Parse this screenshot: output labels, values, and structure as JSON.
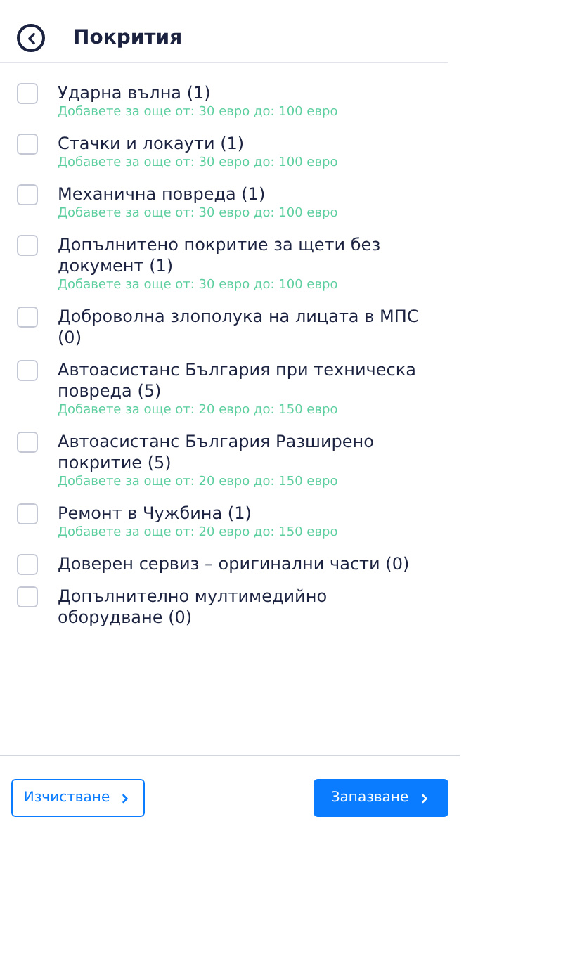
{
  "header": {
    "title": "Покрития"
  },
  "coverages": [
    {
      "label": "Ударна вълна (1)",
      "checked": false,
      "hint": "Добавете за още от: 30 евро до: 100 евро"
    },
    {
      "label": "Стачки и локаути (1)",
      "checked": false,
      "hint": "Добавете за още от: 30 евро до: 100 евро"
    },
    {
      "label": "Механична повреда (1)",
      "checked": false,
      "hint": "Добавете за още от: 30 евро до: 100 евро"
    },
    {
      "label": "Допълнитено покритие за щети без документ (1)",
      "checked": false,
      "hint": "Добавете за още от: 30 евро до: 100 евро"
    },
    {
      "label": "Доброволна злополука на лицата в МПС (0)",
      "checked": false
    },
    {
      "label": "Автоасистанс България при техническа повреда (5)",
      "checked": false,
      "hint": "Добавете за още от: 20 евро до: 150 евро"
    },
    {
      "label": "Автоасистанс България Разширено покритие (5)",
      "checked": false,
      "hint": "Добавете за още от: 20 евро до: 150 евро"
    },
    {
      "label": "Ремонт в Чужбина (1)",
      "checked": false,
      "hint": "Добавете за още от: 20 евро до: 150 евро"
    },
    {
      "label": "Доверен сервиз – оригинални части (0)",
      "checked": false
    },
    {
      "label": "Допълнително мултимедийно оборудване (0)",
      "checked": false
    }
  ],
  "buttons": {
    "clear": "Изчистване",
    "save": "Запазване"
  }
}
